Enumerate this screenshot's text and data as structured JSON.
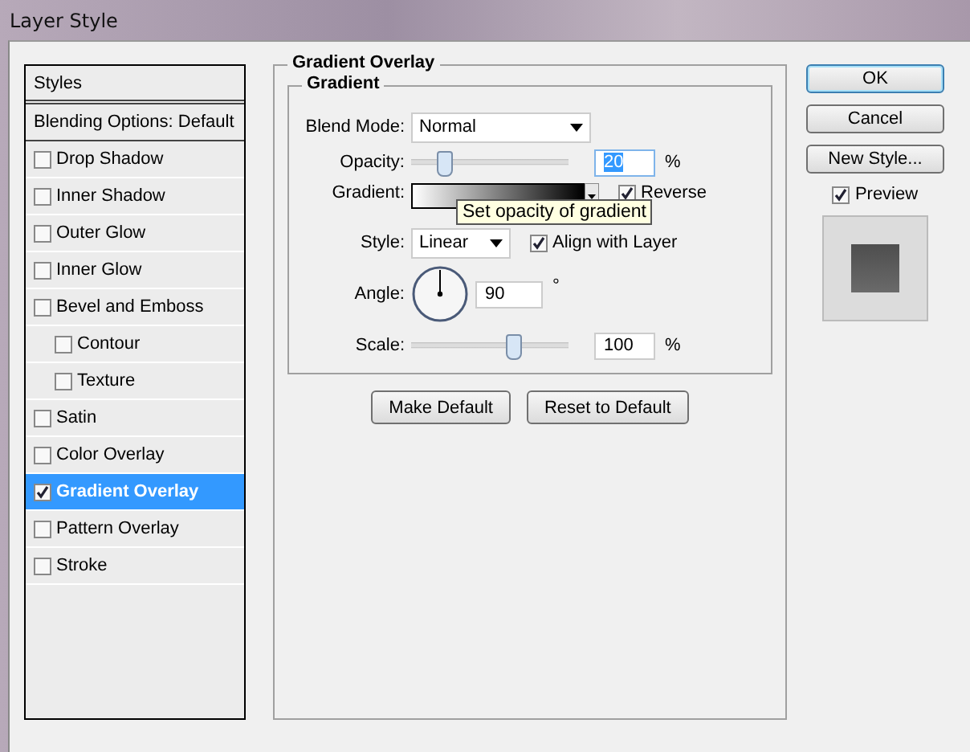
{
  "window": {
    "title": "Layer Style"
  },
  "styles": [
    {
      "kind": "header",
      "label": "Styles",
      "selected": false
    },
    {
      "kind": "header",
      "label": "Blending Options: Default",
      "selected": false
    },
    {
      "kind": "effect",
      "label": "Drop Shadow",
      "checked": false,
      "selected": false
    },
    {
      "kind": "effect",
      "label": "Inner Shadow",
      "checked": false,
      "selected": false
    },
    {
      "kind": "effect",
      "label": "Outer Glow",
      "checked": false,
      "selected": false
    },
    {
      "kind": "effect",
      "label": "Inner Glow",
      "checked": false,
      "selected": false
    },
    {
      "kind": "effect",
      "label": "Bevel and Emboss",
      "checked": false,
      "selected": false,
      "children": [
        {
          "kind": "effect",
          "label": "Contour",
          "checked": false,
          "selected": false
        },
        {
          "kind": "effect",
          "label": "Texture",
          "checked": false,
          "selected": false
        }
      ]
    },
    {
      "kind": "effect",
      "label": "Satin",
      "checked": false,
      "selected": false
    },
    {
      "kind": "effect",
      "label": "Color Overlay",
      "checked": false,
      "selected": false
    },
    {
      "kind": "effect",
      "label": "Gradient Overlay",
      "checked": true,
      "selected": true
    },
    {
      "kind": "effect",
      "label": "Pattern Overlay",
      "checked": false,
      "selected": false
    },
    {
      "kind": "effect",
      "label": "Stroke",
      "checked": false,
      "selected": false
    }
  ],
  "panel": {
    "title": "Gradient Overlay",
    "group": "Gradient",
    "blend_mode": {
      "label": "Blend Mode:",
      "value": "Normal"
    },
    "opacity": {
      "label": "Opacity:",
      "level": 0.2,
      "value": "20",
      "unit": "%"
    },
    "gradient": {
      "label": "Gradient:",
      "reverse": {
        "label": "Reverse",
        "checked": true
      }
    },
    "tooltip": "Set opacity of gradient",
    "style": {
      "label": "Style:",
      "value": "Linear",
      "align": {
        "label": "Align with Layer",
        "checked": true
      }
    },
    "angle": {
      "label": "Angle:",
      "value": "90",
      "unit": "°"
    },
    "scale": {
      "label": "Scale:",
      "level": 0.64,
      "value": "100",
      "unit": "%"
    },
    "buttons": [
      "Make Default",
      "Reset to Default"
    ]
  },
  "actions": [
    {
      "label": "OK",
      "kind": "default"
    },
    {
      "label": "Cancel",
      "kind": "normal"
    },
    {
      "label": "New Style...",
      "kind": "normal"
    }
  ],
  "preview": {
    "label": "Preview",
    "checked": true
  }
}
